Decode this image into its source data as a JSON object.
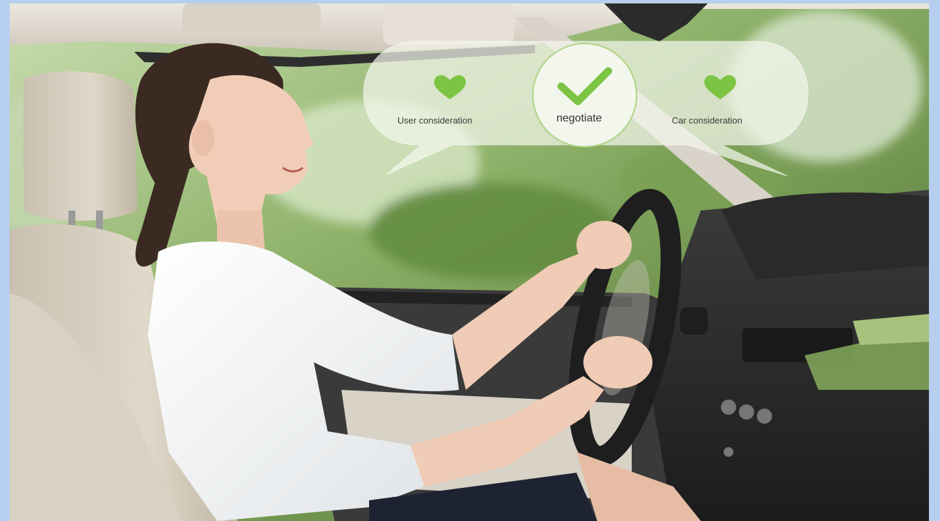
{
  "bubble": {
    "left_label": "User consideration",
    "center_label": "negotiate",
    "right_label": "Car consideration",
    "left_icon": "heart-icon",
    "center_icon": "checkmark-icon",
    "right_icon": "heart-icon"
  },
  "colors": {
    "accent_green": "#7cc443",
    "page_border": "#b7cfee",
    "bubble_fill": "#f4f6ec"
  }
}
